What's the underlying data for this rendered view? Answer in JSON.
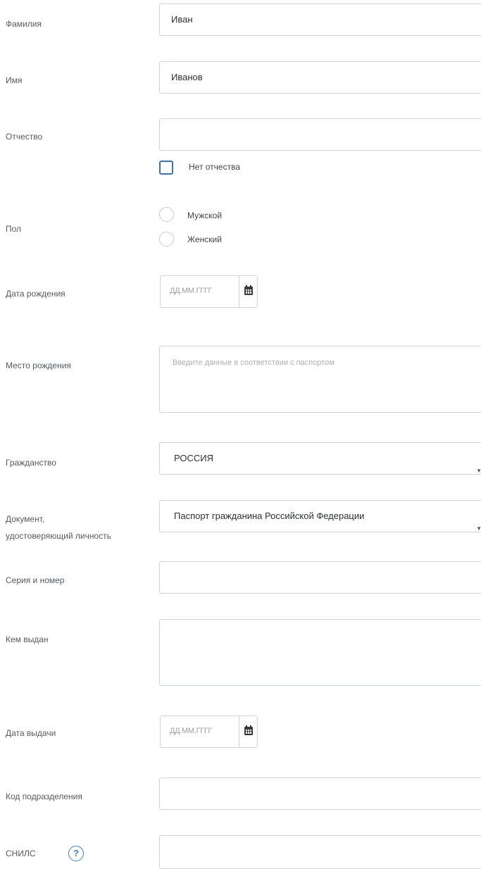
{
  "form": {
    "surname": {
      "label": "Фамилия",
      "value": "Иван"
    },
    "name": {
      "label": "Имя",
      "value": "Иванов"
    },
    "patronymic": {
      "label": "Отчество",
      "value": ""
    },
    "no_patronymic": {
      "label": "Нет отчества",
      "checked": false
    },
    "gender": {
      "label": "Пол",
      "options": [
        "Мужской",
        "Женский"
      ],
      "selected": null
    },
    "birth_date": {
      "label": "Дата рождения",
      "placeholder": "ДД.ММ.ГГГГ",
      "icon": "calendar-icon"
    },
    "birth_place": {
      "label": "Место рождения",
      "placeholder": "Введите данные в соответствии с паспортом"
    },
    "citizenship": {
      "label": "Гражданство",
      "value": "РОССИЯ"
    },
    "id_document": {
      "label_line1": "Документ,",
      "label_line2": "удостоверяющий личность",
      "value": "Паспорт гражданина Российской Федерации"
    },
    "series_number": {
      "label": "Серия и номер",
      "value": ""
    },
    "issued_by": {
      "label": "Кем выдан",
      "value": ""
    },
    "issue_date": {
      "label": "Дата выдачи",
      "placeholder": "ДД.ММ.ГГГГ",
      "icon": "calendar-icon"
    },
    "division_code": {
      "label": "Код подразделения",
      "value": ""
    },
    "snils": {
      "label": "СНИЛС",
      "help": "?",
      "value": ""
    }
  }
}
